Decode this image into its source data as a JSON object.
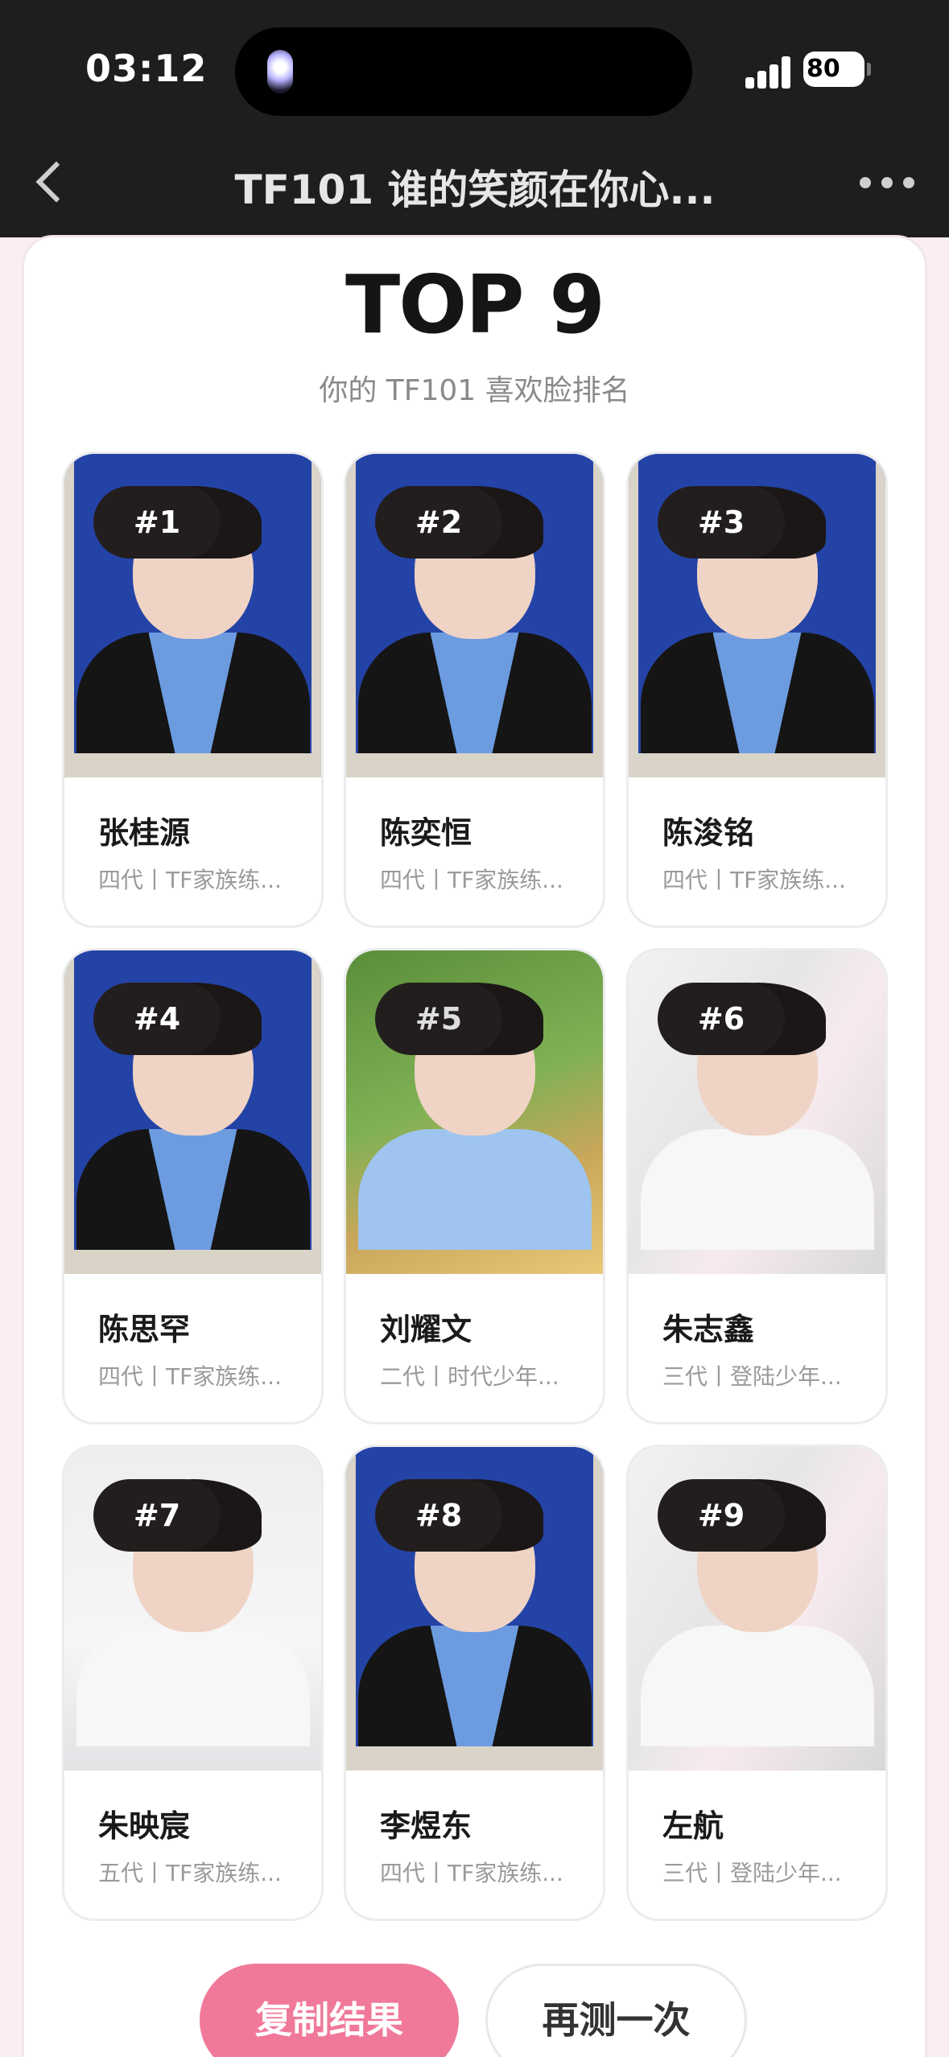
{
  "status": {
    "time": "03:12",
    "battery": "80"
  },
  "nav": {
    "title": "TF101 谁的笑颜在你心..."
  },
  "header": {
    "title": "TOP 9",
    "subtitle": "你的 TF101 喜欢脸排名"
  },
  "results": [
    {
      "rank": "#1",
      "name": "张桂源",
      "desc": "四代丨TF家族练..."
    },
    {
      "rank": "#2",
      "name": "陈奕恒",
      "desc": "四代丨TF家族练..."
    },
    {
      "rank": "#3",
      "name": "陈浚铭",
      "desc": "四代丨TF家族练..."
    },
    {
      "rank": "#4",
      "name": "陈思罕",
      "desc": "四代丨TF家族练..."
    },
    {
      "rank": "#5",
      "name": "刘耀文",
      "desc": "二代丨时代少年..."
    },
    {
      "rank": "#6",
      "name": "朱志鑫",
      "desc": "三代丨登陆少年..."
    },
    {
      "rank": "#7",
      "name": "朱映宸",
      "desc": "五代丨TF家族练..."
    },
    {
      "rank": "#8",
      "name": "李煜东",
      "desc": "四代丨TF家族练..."
    },
    {
      "rank": "#9",
      "name": "左航",
      "desc": "三代丨登陆少年..."
    }
  ],
  "actions": {
    "copy_label": "复制结果",
    "retry_label": "再测一次"
  },
  "colors": {
    "accent": "#f0799a",
    "badge": "#231e1e",
    "topbar": "#1e1e1e"
  }
}
